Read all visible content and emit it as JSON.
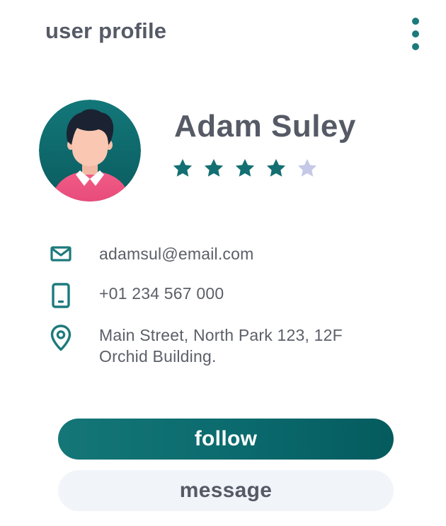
{
  "header": {
    "title": "user profile",
    "menu_icon": "more-vertical-icon"
  },
  "profile": {
    "name": "Adam Suley",
    "rating": {
      "value": 4,
      "max": 5
    },
    "avatar_icon": "avatar-illustration"
  },
  "contact": {
    "email": "adamsul@email.com",
    "phone": "+01 234 567 000",
    "address_line1": "Main Street, North Park 123, 12F",
    "address_line2": "Orchid Building."
  },
  "actions": {
    "follow_label": "follow",
    "message_label": "message"
  },
  "colors": {
    "accent": "#1d7a7c",
    "text": "#555a66",
    "star_filled": "#136f72",
    "star_empty": "#c5c8e6",
    "message_bg": "#f1f5f9"
  }
}
